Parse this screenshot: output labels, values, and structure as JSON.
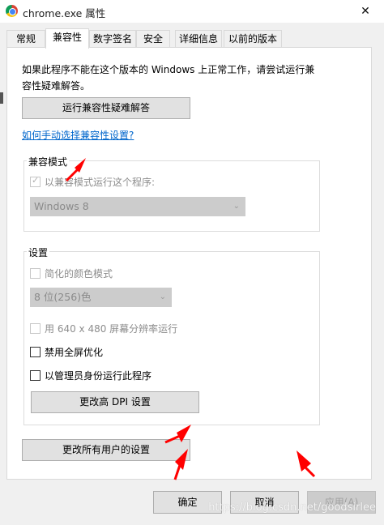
{
  "window": {
    "title": "chrome.exe 属性",
    "close_glyph": "✕"
  },
  "tabs": [
    {
      "label": "常规"
    },
    {
      "label": "兼容性"
    },
    {
      "label": "数字签名"
    },
    {
      "label": "安全"
    },
    {
      "label": "详细信息"
    },
    {
      "label": "以前的版本"
    }
  ],
  "compat": {
    "intro_line1": "如果此程序不能在这个版本的 Windows 上正常工作，请尝试运行兼",
    "intro_line2": "容性疑难解答。",
    "troubleshoot_button": "运行兼容性疑难解答",
    "manual_link": "如何手动选择兼容性设置?",
    "mode_group_label": "兼容模式",
    "mode_checkbox_label": "以兼容模式运行这个程序:",
    "mode_checkbox_checked": true,
    "os_select_value": "Windows 8",
    "settings_group_label": "设置",
    "reduced_color_label": "简化的颜色模式",
    "color_select_value": "8 位(256)色",
    "res_640_label": "用 640 x 480 屏幕分辨率运行",
    "fullscreen_opt_label": "禁用全屏优化",
    "run_as_admin_label": "以管理员身份运行此程序",
    "dpi_button": "更改高 DPI 设置",
    "all_users_button": "更改所有用户的设置"
  },
  "footer": {
    "ok": "确定",
    "cancel": "取消",
    "apply": "应用(A)"
  },
  "watermark": "https://blog.csdn.net/goodsirlee",
  "colors": {
    "link": "#0066cc",
    "annotation_arrow": "#ff0000"
  }
}
